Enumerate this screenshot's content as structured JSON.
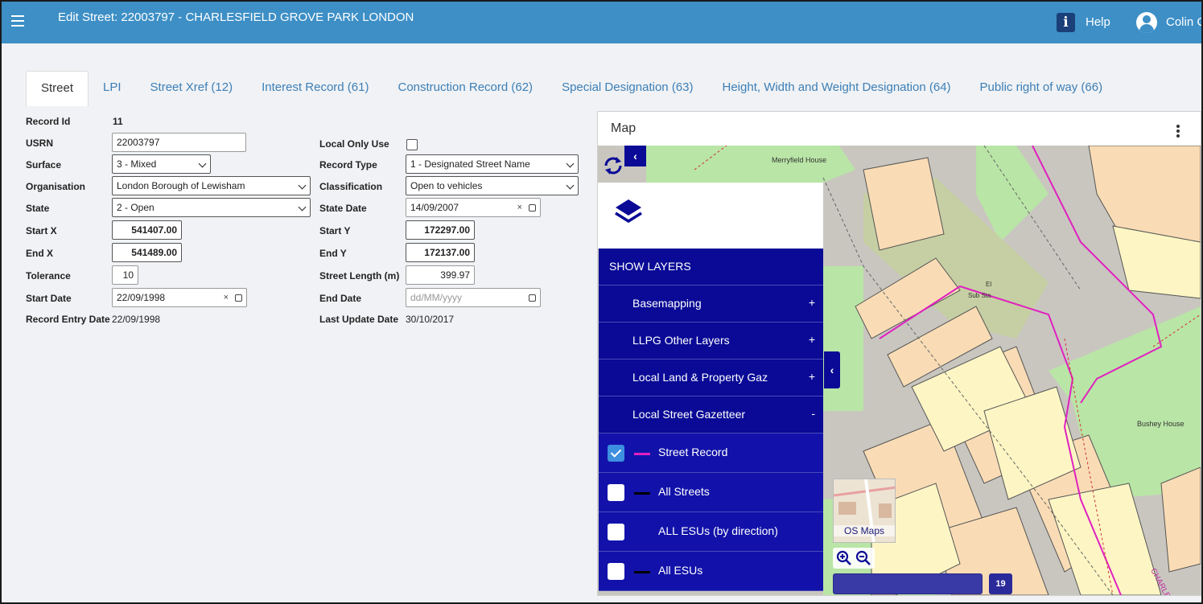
{
  "header": {
    "title": "Edit Street: 22003797 - CHARLESFIELD GROVE PARK LONDON",
    "help_label": "Help",
    "user_name": "Colin C"
  },
  "tabs": [
    {
      "label": "Street",
      "active": true
    },
    {
      "label": "LPI"
    },
    {
      "label": "Street Xref (12)"
    },
    {
      "label": "Interest Record (61)"
    },
    {
      "label": "Construction Record (62)"
    },
    {
      "label": "Special Designation (63)"
    },
    {
      "label": "Height, Width and Weight Designation (64)"
    },
    {
      "label": "Public right of way (66)"
    }
  ],
  "form": {
    "record_id": {
      "label": "Record Id",
      "value": "11"
    },
    "usrn": {
      "label": "USRN",
      "value": "22003797"
    },
    "surface": {
      "label": "Surface",
      "value": "3 - Mixed"
    },
    "organisation": {
      "label": "Organisation",
      "value": "London Borough of Lewisham"
    },
    "state": {
      "label": "State",
      "value": "2 - Open"
    },
    "start_x": {
      "label": "Start X",
      "value": "541407.00"
    },
    "end_x": {
      "label": "End X",
      "value": "541489.00"
    },
    "tolerance": {
      "label": "Tolerance",
      "value": "10"
    },
    "start_date": {
      "label": "Start Date",
      "value": "22/09/1998"
    },
    "record_entry_date": {
      "label": "Record Entry Date",
      "value": "22/09/1998"
    },
    "local_only_use": {
      "label": "Local Only Use",
      "checked": false
    },
    "record_type": {
      "label": "Record Type",
      "value": "1 - Designated Street Name"
    },
    "classification": {
      "label": "Classification",
      "value": "Open to vehicles"
    },
    "state_date": {
      "label": "State Date",
      "value": "14/09/2007"
    },
    "start_y": {
      "label": "Start Y",
      "value": "172297.00"
    },
    "end_y": {
      "label": "End Y",
      "value": "172137.00"
    },
    "street_length": {
      "label": "Street Length (m)",
      "value": "399.97"
    },
    "end_date": {
      "label": "End Date",
      "placeholder": "dd/MM/yyyy"
    },
    "last_update_date": {
      "label": "Last Update Date",
      "value": "30/10/2017"
    },
    "clear_glyph": "×"
  },
  "map": {
    "title": "Map",
    "collapse_glyph": "‹",
    "layers": {
      "show_layers": "SHOW LAYERS",
      "groups": [
        {
          "label": "Basemapping",
          "sign": "+"
        },
        {
          "label": "LLPG Other Layers",
          "sign": "+"
        },
        {
          "label": "Local Land & Property Gaz",
          "sign": "+"
        },
        {
          "label": "Local Street Gazetteer",
          "sign": "-"
        }
      ],
      "items": [
        {
          "label": "Street Record",
          "checked": true,
          "color": "#e020c0"
        },
        {
          "label": "All Streets",
          "checked": false,
          "color": "#000000"
        },
        {
          "label": "ALL ESUs (by direction)",
          "checked": false,
          "color": ""
        },
        {
          "label": "All ESUs",
          "checked": false,
          "color": "#000000"
        }
      ]
    },
    "basemap_label": "OS Maps",
    "zoom_level": "19",
    "map_labels": {
      "merryfield": "Merryfield House",
      "bushey": "Bushey House",
      "sub_sta": "Sub Sta",
      "el": "El",
      "street": "CHARLESFIE"
    },
    "colors": {
      "road": "#c9c6c0",
      "green": "#b9e5a6",
      "building": "#f9dcb5",
      "yellow": "#fdf6c4",
      "street_record": "#e020c0",
      "panel": "#0a0a96"
    }
  }
}
